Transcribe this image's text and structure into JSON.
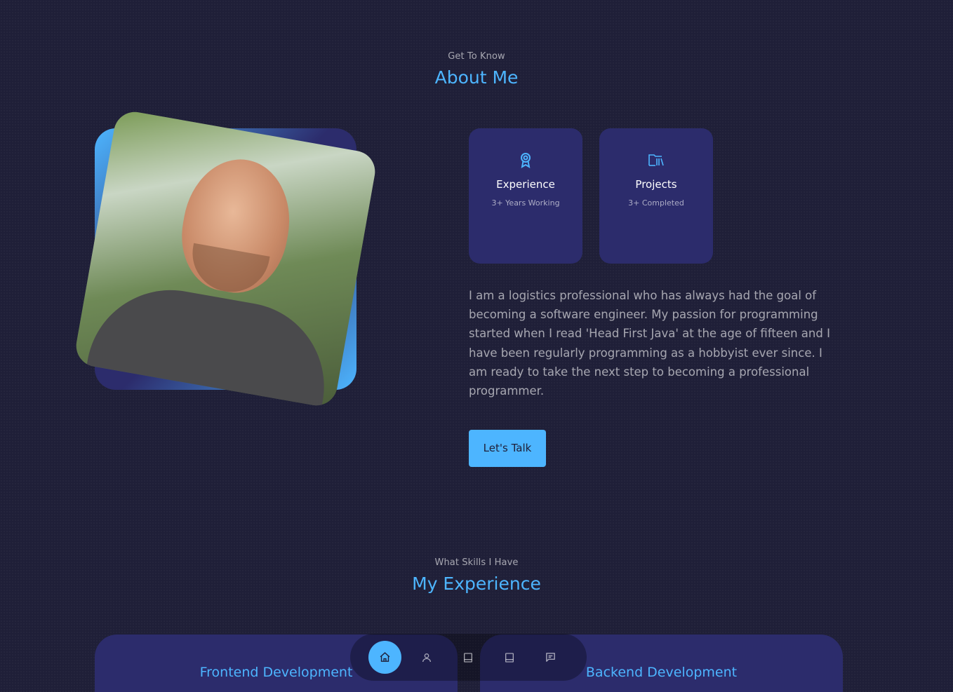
{
  "about": {
    "subtitle": "Get To Know",
    "title": "About Me",
    "cards": [
      {
        "icon": "award-icon",
        "title": "Experience",
        "text": "3+ Years Working"
      },
      {
        "icon": "folder-library-icon",
        "title": "Projects",
        "text": "3+ Completed"
      }
    ],
    "bio": "I am a logistics professional who has always had the goal of becoming a software engineer. My passion for programming started when I read 'Head First Java' at the age of fifteen and I have been regularly programming as a hobbyist ever since. I am ready to take the next step to becoming a professional programmer.",
    "cta_label": "Let's Talk"
  },
  "experience": {
    "subtitle": "What Skills I Have",
    "title": "My Experience",
    "panels": [
      {
        "title": "Frontend Development"
      },
      {
        "title": "Backend Development"
      }
    ]
  },
  "nav": {
    "items": [
      {
        "icon": "home-icon",
        "active": true
      },
      {
        "icon": "user-icon",
        "active": false
      },
      {
        "icon": "book-icon",
        "active": false
      },
      {
        "icon": "book-icon",
        "active": false
      },
      {
        "icon": "message-icon",
        "active": false
      }
    ]
  },
  "colors": {
    "accent": "#4db5ff",
    "background": "#1f1f38",
    "card": "#2c2c6c"
  }
}
